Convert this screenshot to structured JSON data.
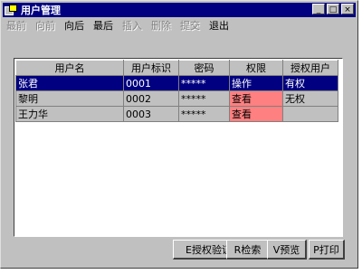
{
  "window": {
    "title": "用户管理"
  },
  "titlebar_buttons": [
    "_",
    "□",
    "×"
  ],
  "menu": [
    {
      "label": "最前",
      "enabled": false
    },
    {
      "label": "向前",
      "enabled": false
    },
    {
      "label": "向后",
      "enabled": true
    },
    {
      "label": "最后",
      "enabled": true
    },
    {
      "label": "插入",
      "enabled": false
    },
    {
      "label": "删除",
      "enabled": false
    },
    {
      "label": "提交",
      "enabled": false
    },
    {
      "label": "退出",
      "enabled": true
    }
  ],
  "table": {
    "columns": [
      "用户名",
      "用户标识",
      "密码",
      "权限",
      "授权用户"
    ],
    "rows": [
      [
        "张君",
        "0001",
        "*****",
        "操作",
        "有权"
      ],
      [
        "黎明",
        "0002",
        "*****",
        "查看",
        "无权"
      ],
      [
        "王力华",
        "0003",
        "*****",
        "查看",
        ""
      ]
    ]
  },
  "buttons": {
    "authorize": "E授权验证",
    "search": "R检索",
    "preview": "V预览",
    "print": "P打印"
  }
}
